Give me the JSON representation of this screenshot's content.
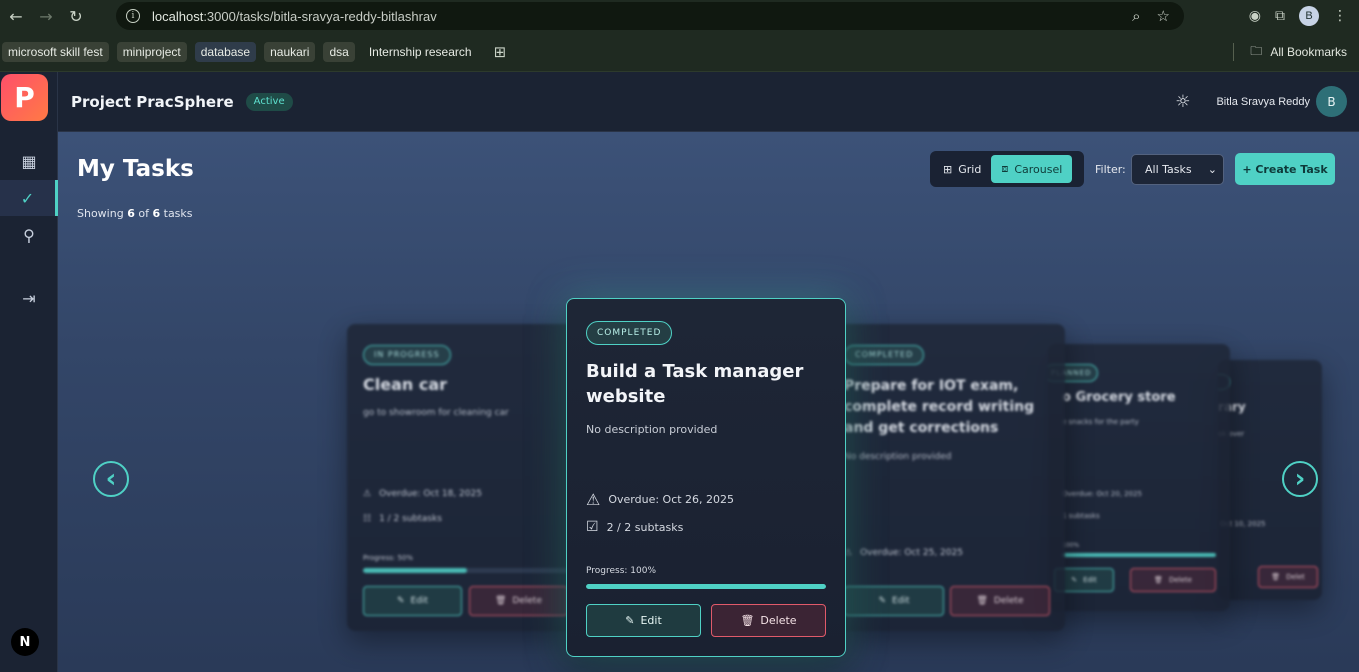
{
  "browser": {
    "url_host": "localhost",
    "url_rest": ":3000/tasks/bitla-sravya-reddy-bitlashrav",
    "bookmarks": [
      "microsoft skill fest",
      "miniproject",
      "database",
      "naukari",
      "dsa",
      "Internship research"
    ],
    "all_bookmarks": "All Bookmarks",
    "profile_initial": "B"
  },
  "app": {
    "logo_letter": "P",
    "title": "Project PracSphere",
    "status": "Active",
    "user_name": "Bitla Sravya Reddy",
    "user_initial": "B",
    "next_badge": "N"
  },
  "page": {
    "title": "My Tasks",
    "showing_prefix": "Showing",
    "showing_count": "6",
    "showing_of": "of",
    "showing_total": "6",
    "showing_suffix": "tasks",
    "grid_label": "Grid",
    "carousel_label": "Carousel",
    "filter_label": "Filter:",
    "filter_value": "All Tasks",
    "create_label": "+ Create Task"
  },
  "cards": {
    "center": {
      "status": "COMPLETED",
      "title": "Build a Task manager website",
      "description": "No description provided",
      "due": "Overdue: Oct 26, 2025",
      "subtasks": "2 / 2 subtasks",
      "progress_label": "Progress: 100%",
      "progress": 1.0,
      "edit": "Edit",
      "delete": "Delete"
    },
    "left": {
      "status": "IN PROGRESS",
      "title": "Clean car",
      "description": "go to showroom for cleaning car",
      "due": "Overdue: Oct 18, 2025",
      "subtasks": "1 / 2 subtasks",
      "progress_label": "Progress: 50%",
      "progress": 0.5,
      "edit": "Edit",
      "delete": "Delete"
    },
    "right1": {
      "status": "COMPLETED",
      "title": "Prepare for IOT exam, complete record writing and get corrections",
      "description": "No description provided",
      "due": "Overdue: Oct 25, 2025",
      "edit": "Edit",
      "delete": "Delete"
    },
    "right2": {
      "status": "PLANNED",
      "title": "o Grocery store",
      "description": "e snacks for the party",
      "due": "Overdue: Oct 20, 2025",
      "subtasks": "1 subtasks",
      "progress_label": "100%",
      "progress": 1.0,
      "edit": "Edit",
      "delete": "Delete"
    },
    "right3": {
      "title": "rary",
      "description": "ok over",
      "due": "Oct 10, 2025",
      "delete": "Delet"
    }
  }
}
